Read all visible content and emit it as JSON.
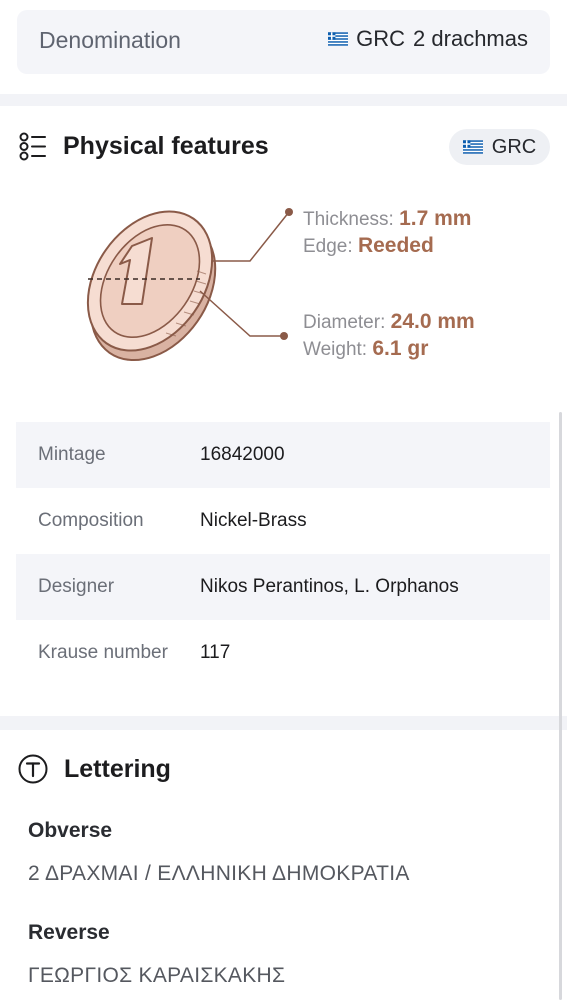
{
  "denomination": {
    "label": "Denomination",
    "flag_icon": "greece-flag-icon",
    "country": "GRC",
    "value": "2 drachmas"
  },
  "physical": {
    "title": "Physical features",
    "icon": "list-icon",
    "badge_flag_icon": "greece-flag-icon",
    "badge_label": "GRC",
    "thickness_label": "Thickness:",
    "thickness_value": "1.7 mm",
    "edge_label": "Edge:",
    "edge_value": "Reeded",
    "diameter_label": "Diameter:",
    "diameter_value": "24.0 mm",
    "weight_label": "Weight:",
    "weight_value": "6.1 gr",
    "accent_color": "#a56b50"
  },
  "specs": [
    {
      "label": "Mintage",
      "value": "16842000"
    },
    {
      "label": "Composition",
      "value": "Nickel-Brass"
    },
    {
      "label": "Designer",
      "value": "Nikos Perantinos, L. Orphanos"
    },
    {
      "label": "Krause number",
      "value": "117"
    }
  ],
  "lettering": {
    "title": "Lettering",
    "icon": "text-t-icon",
    "obverse_title": "Obverse",
    "obverse_text": "2 ΔΡΑΧΜΑΙ / ΕΛΛΗΝΙΚΗ ΔΗΜΟΚΡΑΤΙΑ",
    "reverse_title": "Reverse",
    "reverse_text": "ΓΕΩΡΓΙΟΣ ΚΑΡΑΙΣΚΑΚΗΣ"
  }
}
